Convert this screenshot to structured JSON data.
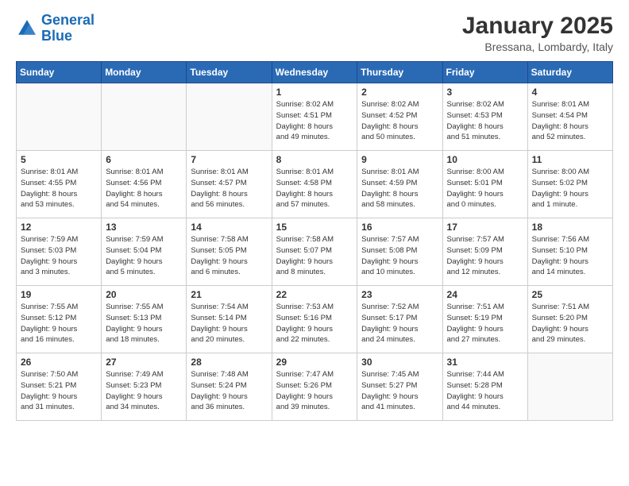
{
  "header": {
    "logo_line1": "General",
    "logo_line2": "Blue",
    "month": "January 2025",
    "location": "Bressana, Lombardy, Italy"
  },
  "days_of_week": [
    "Sunday",
    "Monday",
    "Tuesday",
    "Wednesday",
    "Thursday",
    "Friday",
    "Saturday"
  ],
  "weeks": [
    [
      {
        "day": "",
        "content": ""
      },
      {
        "day": "",
        "content": ""
      },
      {
        "day": "",
        "content": ""
      },
      {
        "day": "1",
        "content": "Sunrise: 8:02 AM\nSunset: 4:51 PM\nDaylight: 8 hours\nand 49 minutes."
      },
      {
        "day": "2",
        "content": "Sunrise: 8:02 AM\nSunset: 4:52 PM\nDaylight: 8 hours\nand 50 minutes."
      },
      {
        "day": "3",
        "content": "Sunrise: 8:02 AM\nSunset: 4:53 PM\nDaylight: 8 hours\nand 51 minutes."
      },
      {
        "day": "4",
        "content": "Sunrise: 8:01 AM\nSunset: 4:54 PM\nDaylight: 8 hours\nand 52 minutes."
      }
    ],
    [
      {
        "day": "5",
        "content": "Sunrise: 8:01 AM\nSunset: 4:55 PM\nDaylight: 8 hours\nand 53 minutes."
      },
      {
        "day": "6",
        "content": "Sunrise: 8:01 AM\nSunset: 4:56 PM\nDaylight: 8 hours\nand 54 minutes."
      },
      {
        "day": "7",
        "content": "Sunrise: 8:01 AM\nSunset: 4:57 PM\nDaylight: 8 hours\nand 56 minutes."
      },
      {
        "day": "8",
        "content": "Sunrise: 8:01 AM\nSunset: 4:58 PM\nDaylight: 8 hours\nand 57 minutes."
      },
      {
        "day": "9",
        "content": "Sunrise: 8:01 AM\nSunset: 4:59 PM\nDaylight: 8 hours\nand 58 minutes."
      },
      {
        "day": "10",
        "content": "Sunrise: 8:00 AM\nSunset: 5:01 PM\nDaylight: 9 hours\nand 0 minutes."
      },
      {
        "day": "11",
        "content": "Sunrise: 8:00 AM\nSunset: 5:02 PM\nDaylight: 9 hours\nand 1 minute."
      }
    ],
    [
      {
        "day": "12",
        "content": "Sunrise: 7:59 AM\nSunset: 5:03 PM\nDaylight: 9 hours\nand 3 minutes."
      },
      {
        "day": "13",
        "content": "Sunrise: 7:59 AM\nSunset: 5:04 PM\nDaylight: 9 hours\nand 5 minutes."
      },
      {
        "day": "14",
        "content": "Sunrise: 7:58 AM\nSunset: 5:05 PM\nDaylight: 9 hours\nand 6 minutes."
      },
      {
        "day": "15",
        "content": "Sunrise: 7:58 AM\nSunset: 5:07 PM\nDaylight: 9 hours\nand 8 minutes."
      },
      {
        "day": "16",
        "content": "Sunrise: 7:57 AM\nSunset: 5:08 PM\nDaylight: 9 hours\nand 10 minutes."
      },
      {
        "day": "17",
        "content": "Sunrise: 7:57 AM\nSunset: 5:09 PM\nDaylight: 9 hours\nand 12 minutes."
      },
      {
        "day": "18",
        "content": "Sunrise: 7:56 AM\nSunset: 5:10 PM\nDaylight: 9 hours\nand 14 minutes."
      }
    ],
    [
      {
        "day": "19",
        "content": "Sunrise: 7:55 AM\nSunset: 5:12 PM\nDaylight: 9 hours\nand 16 minutes."
      },
      {
        "day": "20",
        "content": "Sunrise: 7:55 AM\nSunset: 5:13 PM\nDaylight: 9 hours\nand 18 minutes."
      },
      {
        "day": "21",
        "content": "Sunrise: 7:54 AM\nSunset: 5:14 PM\nDaylight: 9 hours\nand 20 minutes."
      },
      {
        "day": "22",
        "content": "Sunrise: 7:53 AM\nSunset: 5:16 PM\nDaylight: 9 hours\nand 22 minutes."
      },
      {
        "day": "23",
        "content": "Sunrise: 7:52 AM\nSunset: 5:17 PM\nDaylight: 9 hours\nand 24 minutes."
      },
      {
        "day": "24",
        "content": "Sunrise: 7:51 AM\nSunset: 5:19 PM\nDaylight: 9 hours\nand 27 minutes."
      },
      {
        "day": "25",
        "content": "Sunrise: 7:51 AM\nSunset: 5:20 PM\nDaylight: 9 hours\nand 29 minutes."
      }
    ],
    [
      {
        "day": "26",
        "content": "Sunrise: 7:50 AM\nSunset: 5:21 PM\nDaylight: 9 hours\nand 31 minutes."
      },
      {
        "day": "27",
        "content": "Sunrise: 7:49 AM\nSunset: 5:23 PM\nDaylight: 9 hours\nand 34 minutes."
      },
      {
        "day": "28",
        "content": "Sunrise: 7:48 AM\nSunset: 5:24 PM\nDaylight: 9 hours\nand 36 minutes."
      },
      {
        "day": "29",
        "content": "Sunrise: 7:47 AM\nSunset: 5:26 PM\nDaylight: 9 hours\nand 39 minutes."
      },
      {
        "day": "30",
        "content": "Sunrise: 7:45 AM\nSunset: 5:27 PM\nDaylight: 9 hours\nand 41 minutes."
      },
      {
        "day": "31",
        "content": "Sunrise: 7:44 AM\nSunset: 5:28 PM\nDaylight: 9 hours\nand 44 minutes."
      },
      {
        "day": "",
        "content": ""
      }
    ]
  ]
}
